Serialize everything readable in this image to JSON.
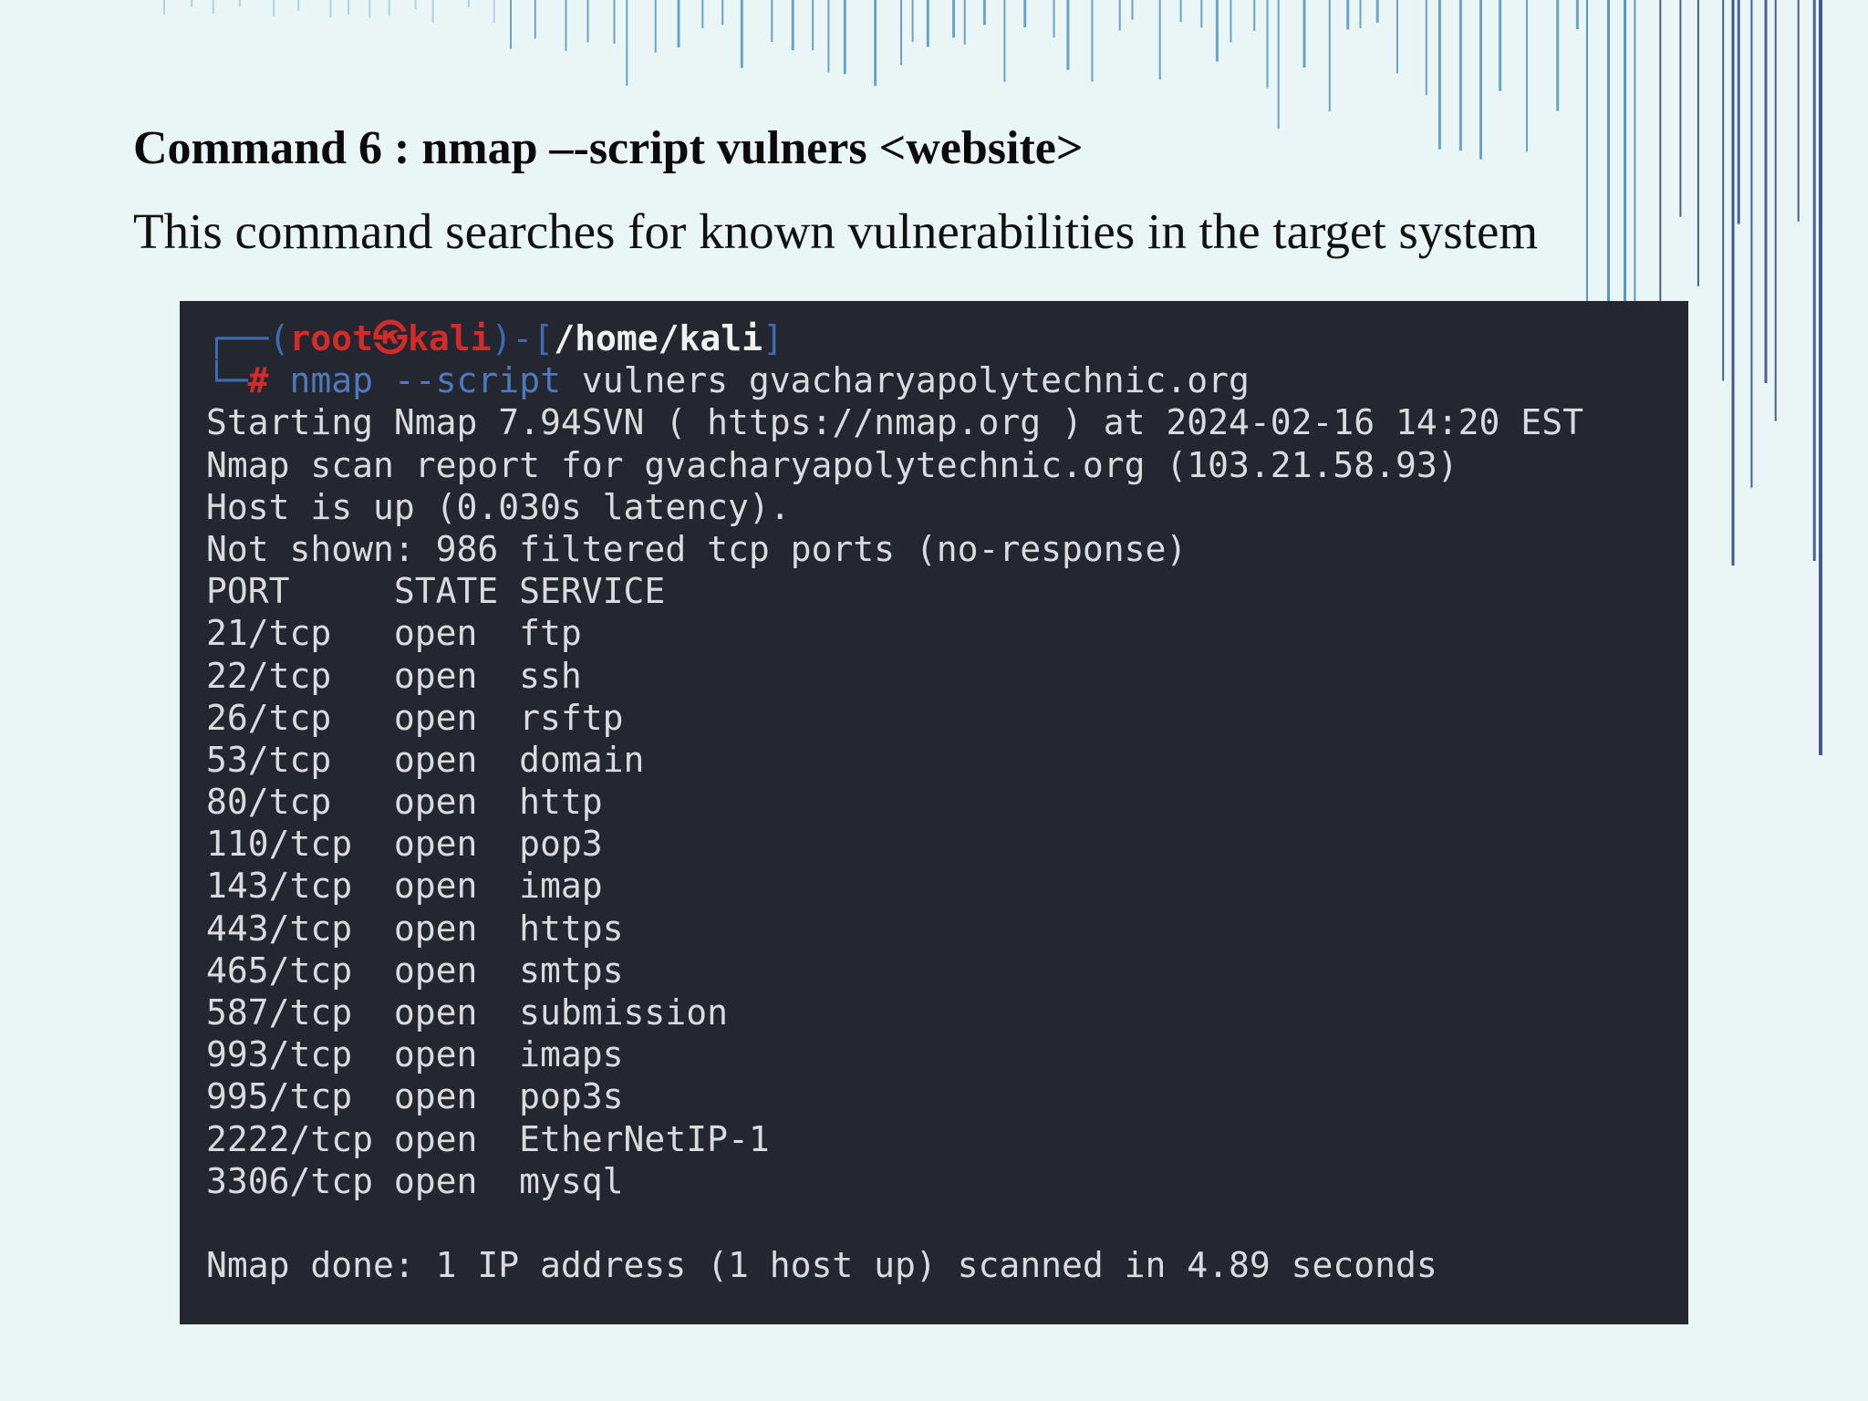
{
  "slide": {
    "title": "Command 6 : nmap –-script vulners <website>",
    "description": "This command searches for known vulnerabilities in the target system"
  },
  "terminal": {
    "prompt": {
      "box_top": "┌──(",
      "user_host": "root㉿kali",
      "mid": ")-[",
      "path": "/home/kali",
      "end": "]",
      "box_bottom": "└─",
      "hash": "# ",
      "command": "nmap --script",
      "args": " vulners gvacharyapolytechnic.org"
    },
    "output": [
      "Starting Nmap 7.94SVN ( https://nmap.org ) at 2024-02-16 14:20 EST",
      "Nmap scan report for gvacharyapolytechnic.org (103.21.58.93)",
      "Host is up (0.030s latency).",
      "Not shown: 986 filtered tcp ports (no-response)",
      "PORT     STATE SERVICE",
      "21/tcp   open  ftp",
      "22/tcp   open  ssh",
      "26/tcp   open  rsftp",
      "53/tcp   open  domain",
      "80/tcp   open  http",
      "110/tcp  open  pop3",
      "143/tcp  open  imap",
      "443/tcp  open  https",
      "465/tcp  open  smtps",
      "587/tcp  open  submission",
      "993/tcp  open  imaps",
      "995/tcp  open  pop3s",
      "2222/tcp open  EtherNetIP-1",
      "3306/tcp open  mysql"
    ],
    "footer": "Nmap done: 1 IP address (1 host up) scanned in 4.89 seconds"
  },
  "colors": {
    "background": "#eaf5f6",
    "terminal_bg": "#242730",
    "terminal_text": "#d9dbdf",
    "prompt_red": "#d32a2a",
    "prompt_blue": "#3d6bb5"
  }
}
